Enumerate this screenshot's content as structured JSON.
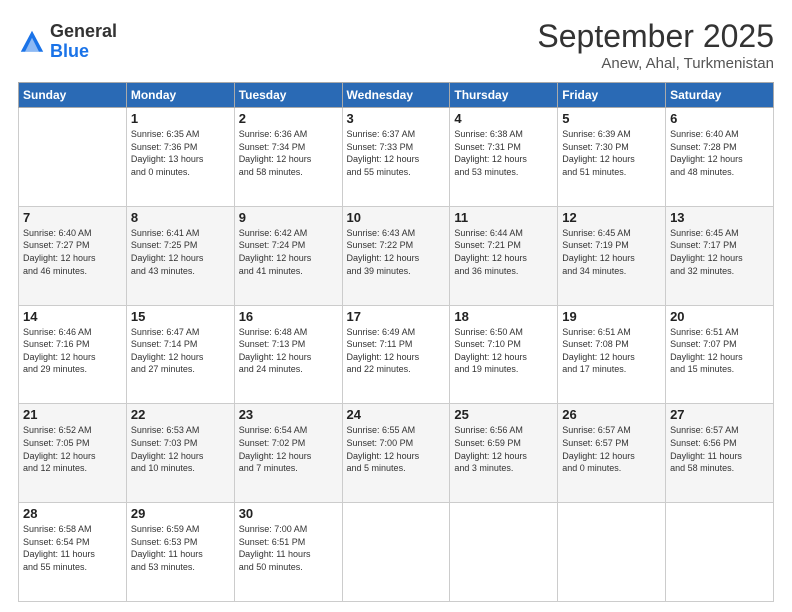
{
  "logo": {
    "general": "General",
    "blue": "Blue"
  },
  "header": {
    "month": "September 2025",
    "location": "Anew, Ahal, Turkmenistan"
  },
  "days_of_week": [
    "Sunday",
    "Monday",
    "Tuesday",
    "Wednesday",
    "Thursday",
    "Friday",
    "Saturday"
  ],
  "weeks": [
    [
      {
        "day": "",
        "info": ""
      },
      {
        "day": "1",
        "info": "Sunrise: 6:35 AM\nSunset: 7:36 PM\nDaylight: 13 hours\nand 0 minutes."
      },
      {
        "day": "2",
        "info": "Sunrise: 6:36 AM\nSunset: 7:34 PM\nDaylight: 12 hours\nand 58 minutes."
      },
      {
        "day": "3",
        "info": "Sunrise: 6:37 AM\nSunset: 7:33 PM\nDaylight: 12 hours\nand 55 minutes."
      },
      {
        "day": "4",
        "info": "Sunrise: 6:38 AM\nSunset: 7:31 PM\nDaylight: 12 hours\nand 53 minutes."
      },
      {
        "day": "5",
        "info": "Sunrise: 6:39 AM\nSunset: 7:30 PM\nDaylight: 12 hours\nand 51 minutes."
      },
      {
        "day": "6",
        "info": "Sunrise: 6:40 AM\nSunset: 7:28 PM\nDaylight: 12 hours\nand 48 minutes."
      }
    ],
    [
      {
        "day": "7",
        "info": "Sunrise: 6:40 AM\nSunset: 7:27 PM\nDaylight: 12 hours\nand 46 minutes."
      },
      {
        "day": "8",
        "info": "Sunrise: 6:41 AM\nSunset: 7:25 PM\nDaylight: 12 hours\nand 43 minutes."
      },
      {
        "day": "9",
        "info": "Sunrise: 6:42 AM\nSunset: 7:24 PM\nDaylight: 12 hours\nand 41 minutes."
      },
      {
        "day": "10",
        "info": "Sunrise: 6:43 AM\nSunset: 7:22 PM\nDaylight: 12 hours\nand 39 minutes."
      },
      {
        "day": "11",
        "info": "Sunrise: 6:44 AM\nSunset: 7:21 PM\nDaylight: 12 hours\nand 36 minutes."
      },
      {
        "day": "12",
        "info": "Sunrise: 6:45 AM\nSunset: 7:19 PM\nDaylight: 12 hours\nand 34 minutes."
      },
      {
        "day": "13",
        "info": "Sunrise: 6:45 AM\nSunset: 7:17 PM\nDaylight: 12 hours\nand 32 minutes."
      }
    ],
    [
      {
        "day": "14",
        "info": "Sunrise: 6:46 AM\nSunset: 7:16 PM\nDaylight: 12 hours\nand 29 minutes."
      },
      {
        "day": "15",
        "info": "Sunrise: 6:47 AM\nSunset: 7:14 PM\nDaylight: 12 hours\nand 27 minutes."
      },
      {
        "day": "16",
        "info": "Sunrise: 6:48 AM\nSunset: 7:13 PM\nDaylight: 12 hours\nand 24 minutes."
      },
      {
        "day": "17",
        "info": "Sunrise: 6:49 AM\nSunset: 7:11 PM\nDaylight: 12 hours\nand 22 minutes."
      },
      {
        "day": "18",
        "info": "Sunrise: 6:50 AM\nSunset: 7:10 PM\nDaylight: 12 hours\nand 19 minutes."
      },
      {
        "day": "19",
        "info": "Sunrise: 6:51 AM\nSunset: 7:08 PM\nDaylight: 12 hours\nand 17 minutes."
      },
      {
        "day": "20",
        "info": "Sunrise: 6:51 AM\nSunset: 7:07 PM\nDaylight: 12 hours\nand 15 minutes."
      }
    ],
    [
      {
        "day": "21",
        "info": "Sunrise: 6:52 AM\nSunset: 7:05 PM\nDaylight: 12 hours\nand 12 minutes."
      },
      {
        "day": "22",
        "info": "Sunrise: 6:53 AM\nSunset: 7:03 PM\nDaylight: 12 hours\nand 10 minutes."
      },
      {
        "day": "23",
        "info": "Sunrise: 6:54 AM\nSunset: 7:02 PM\nDaylight: 12 hours\nand 7 minutes."
      },
      {
        "day": "24",
        "info": "Sunrise: 6:55 AM\nSunset: 7:00 PM\nDaylight: 12 hours\nand 5 minutes."
      },
      {
        "day": "25",
        "info": "Sunrise: 6:56 AM\nSunset: 6:59 PM\nDaylight: 12 hours\nand 3 minutes."
      },
      {
        "day": "26",
        "info": "Sunrise: 6:57 AM\nSunset: 6:57 PM\nDaylight: 12 hours\nand 0 minutes."
      },
      {
        "day": "27",
        "info": "Sunrise: 6:57 AM\nSunset: 6:56 PM\nDaylight: 11 hours\nand 58 minutes."
      }
    ],
    [
      {
        "day": "28",
        "info": "Sunrise: 6:58 AM\nSunset: 6:54 PM\nDaylight: 11 hours\nand 55 minutes."
      },
      {
        "day": "29",
        "info": "Sunrise: 6:59 AM\nSunset: 6:53 PM\nDaylight: 11 hours\nand 53 minutes."
      },
      {
        "day": "30",
        "info": "Sunrise: 7:00 AM\nSunset: 6:51 PM\nDaylight: 11 hours\nand 50 minutes."
      },
      {
        "day": "",
        "info": ""
      },
      {
        "day": "",
        "info": ""
      },
      {
        "day": "",
        "info": ""
      },
      {
        "day": "",
        "info": ""
      }
    ]
  ]
}
